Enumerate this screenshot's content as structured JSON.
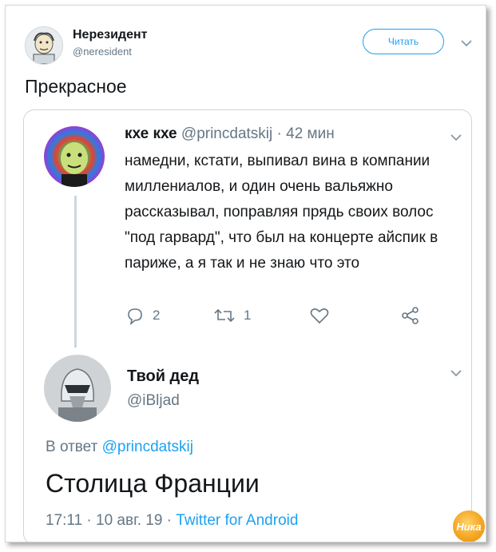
{
  "author": {
    "name": "Нерезидент",
    "handle": "@neresident"
  },
  "follow_button": "Читать",
  "tweet_text": "Прекрасное",
  "quoted": {
    "name": "кхе кхе",
    "handle": "@princdatskij",
    "separator": " · ",
    "time": "42 мин",
    "body": "намедни, кстати, выпивал вина в компании миллениалов, и один очень вальяжно рассказывал, поправляя прядь своих волос \"под гарвард\", что был на концерте айспик в париже, а я так и не знаю что это",
    "replies": "2",
    "retweets": "1"
  },
  "reply": {
    "name": "Твой дед",
    "handle": "@iBljad",
    "reply_to_prefix": "В ответ",
    "reply_to_handle": "@princdatskij",
    "text": "Столица Франции",
    "timestamp": "17:11 · 10 авг. 19 ·",
    "source": "Twitter for Android"
  },
  "watermark": "Ника",
  "colors": {
    "accent": "#1da1f2",
    "muted": "#657786",
    "border": "#ccd6dd",
    "text": "#14171a"
  }
}
